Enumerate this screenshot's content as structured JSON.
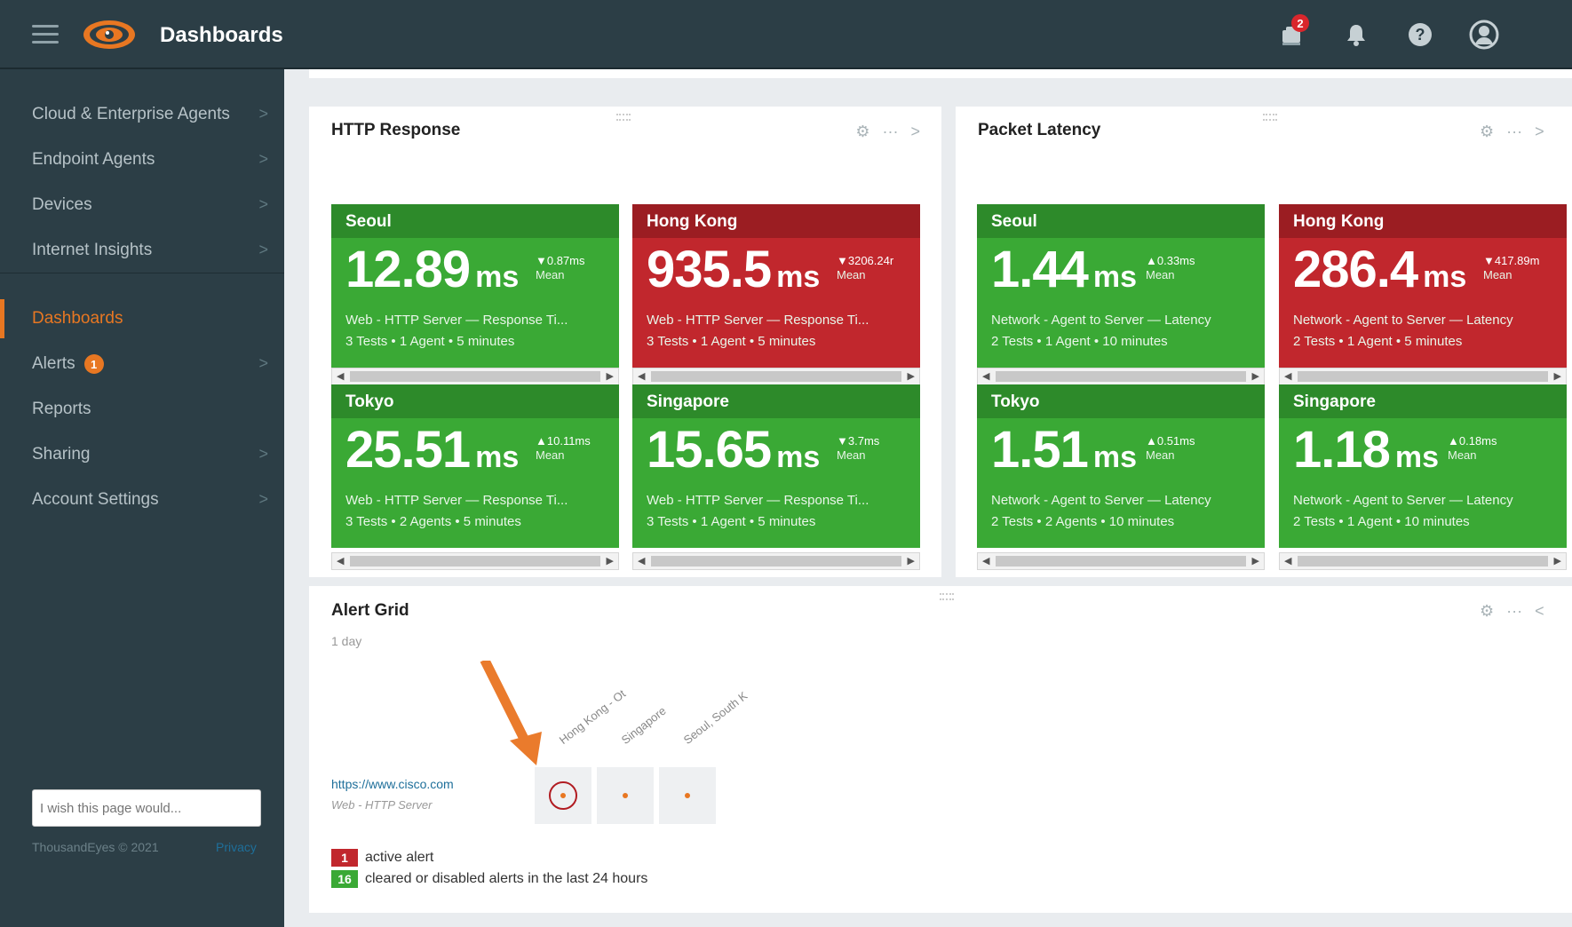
{
  "header": {
    "title": "Dashboards",
    "notification_count": "2"
  },
  "sidebar": {
    "items": [
      {
        "label": "Cloud & Enterprise Agents"
      },
      {
        "label": "Endpoint Agents"
      },
      {
        "label": "Devices"
      },
      {
        "label": "Internet Insights"
      },
      {
        "label": "Dashboards"
      },
      {
        "label": "Alerts",
        "badge": "1"
      },
      {
        "label": "Reports"
      },
      {
        "label": "Sharing"
      },
      {
        "label": "Account Settings"
      }
    ],
    "feedback_placeholder": "I wish this page would...",
    "copyright": "ThousandEyes © 2021",
    "privacy": "Privacy"
  },
  "colors": {
    "accent": "#e87722",
    "healthy": "#3aa935",
    "alert": "#c1272d",
    "nav_bg": "#2c3e46"
  },
  "panels": {
    "http": {
      "title": "HTTP Response",
      "tiles": [
        {
          "name": "Seoul",
          "value": "12.89",
          "unit": "ms",
          "delta": "▼0.87ms",
          "mean": "Mean",
          "desc": "Web - HTTP Server — Response Ti...",
          "meta": "3 Tests • 1 Agent • 5 minutes",
          "status": "ok"
        },
        {
          "name": "Hong Kong",
          "value": "935.5",
          "unit": "ms",
          "delta": "▼3206.24r",
          "mean": "Mean",
          "desc": "Web - HTTP Server — Response Ti...",
          "meta": "3 Tests • 1 Agent • 5 minutes",
          "status": "alert"
        },
        {
          "name": "Tokyo",
          "value": "25.51",
          "unit": "ms",
          "delta": "▲10.11ms",
          "mean": "Mean",
          "desc": "Web - HTTP Server — Response Ti...",
          "meta": "3 Tests • 2 Agents • 5 minutes",
          "status": "ok"
        },
        {
          "name": "Singapore",
          "value": "15.65",
          "unit": "ms",
          "delta": "▼3.7ms",
          "mean": "Mean",
          "desc": "Web - HTTP Server — Response Ti...",
          "meta": "3 Tests • 1 Agent • 5 minutes",
          "status": "ok"
        }
      ]
    },
    "latency": {
      "title": "Packet Latency",
      "tiles": [
        {
          "name": "Seoul",
          "value": "1.44",
          "unit": "ms",
          "delta": "▲0.33ms",
          "mean": "Mean",
          "desc": "Network - Agent to Server — Latency",
          "meta": "2 Tests • 1 Agent • 10 minutes",
          "status": "ok"
        },
        {
          "name": "Hong Kong",
          "value": "286.4",
          "unit": "ms",
          "delta": "▼417.89m",
          "mean": "Mean",
          "desc": "Network - Agent to Server — Latency",
          "meta": "2 Tests • 1 Agent • 5 minutes",
          "status": "alert"
        },
        {
          "name": "Tokyo",
          "value": "1.51",
          "unit": "ms",
          "delta": "▲0.51ms",
          "mean": "Mean",
          "desc": "Network - Agent to Server — Latency",
          "meta": "2 Tests • 2 Agents • 10 minutes",
          "status": "ok"
        },
        {
          "name": "Singapore",
          "value": "1.18",
          "unit": "ms",
          "delta": "▲0.18ms",
          "mean": "Mean",
          "desc": "Network - Agent to Server — Latency",
          "meta": "2 Tests • 1 Agent • 10 minutes",
          "status": "ok"
        }
      ]
    },
    "alert_grid": {
      "title": "Alert Grid",
      "range": "1 day",
      "columns": [
        "Hong Kong - Ot",
        "Singapore",
        "Seoul, South K"
      ],
      "row_url": "https://www.cisco.com",
      "row_type": "Web - HTTP Server",
      "legend": [
        {
          "count": "1",
          "text": "active alert"
        },
        {
          "count": "16",
          "text": "cleared or disabled alerts in the last 24 hours"
        }
      ]
    }
  }
}
